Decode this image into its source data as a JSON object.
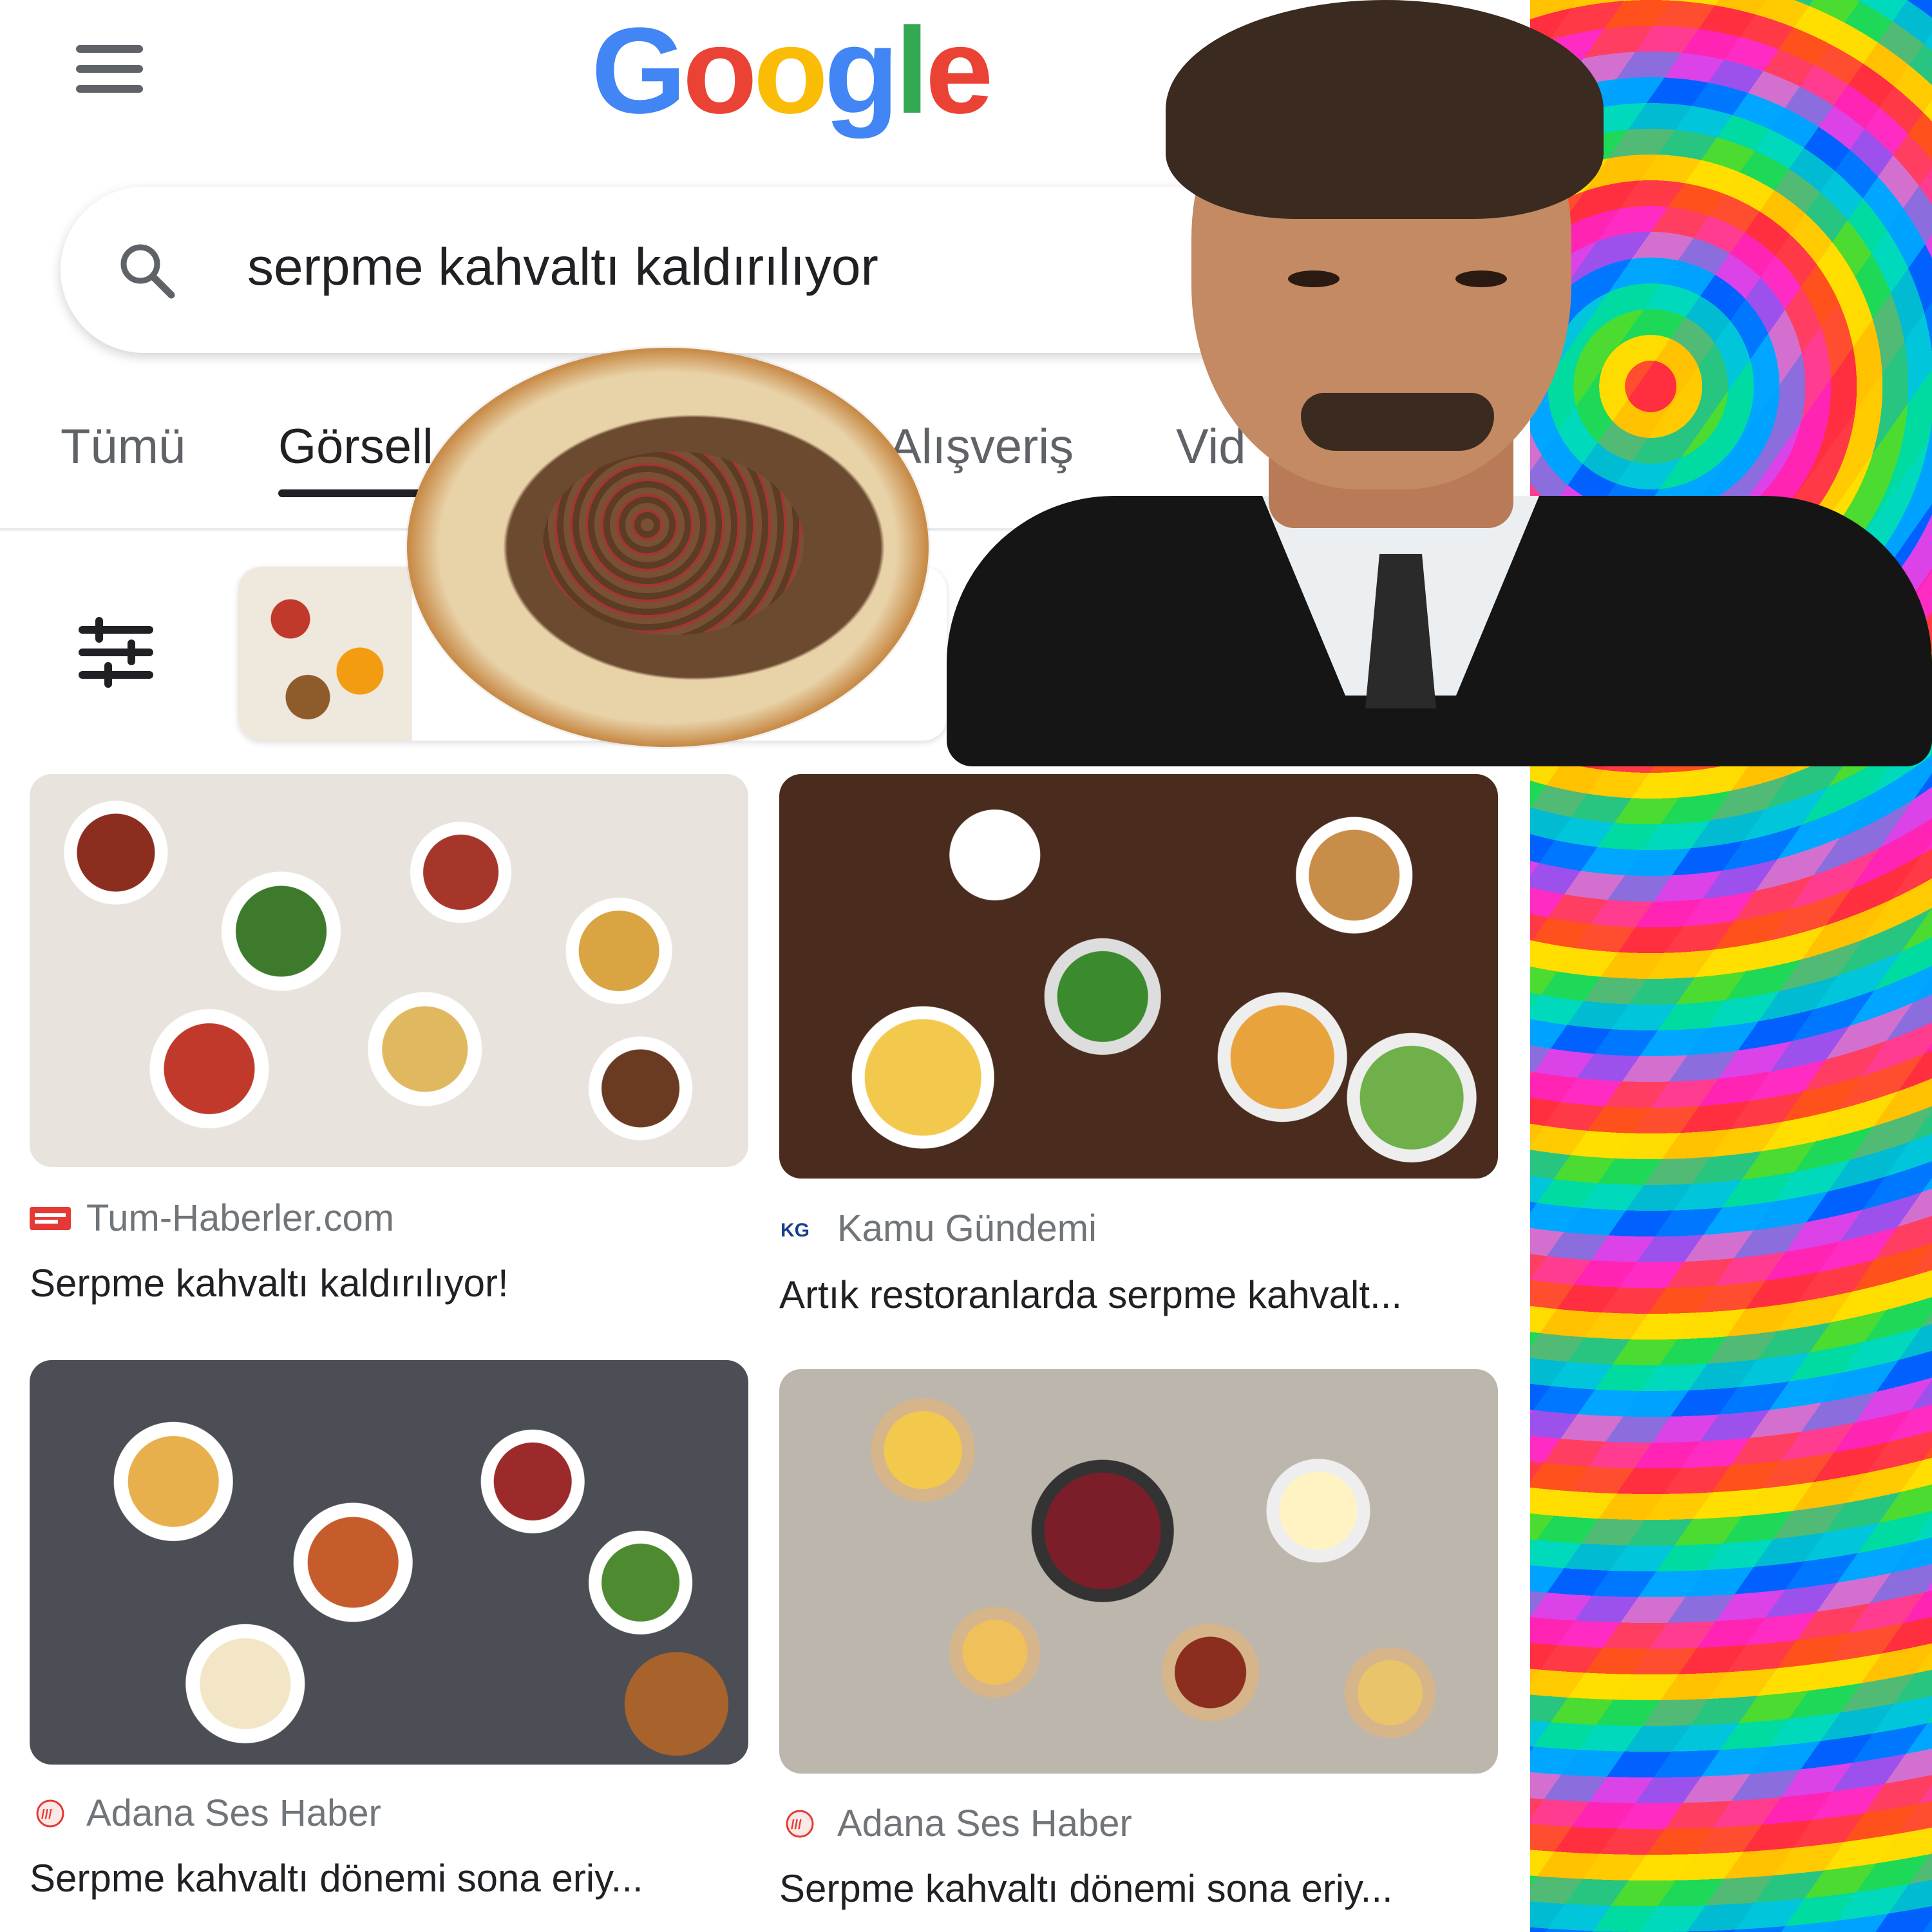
{
  "header": {
    "menu_icon": "hamburger-menu-icon",
    "logo_letters": [
      {
        "char": "G",
        "color": "#4285F4"
      },
      {
        "char": "o",
        "color": "#EA4335"
      },
      {
        "char": "o",
        "color": "#FBBC05"
      },
      {
        "char": "g",
        "color": "#4285F4"
      },
      {
        "char": "l",
        "color": "#34A853"
      },
      {
        "char": "e",
        "color": "#EA4335"
      }
    ]
  },
  "search": {
    "query": "serpme kahvaltı kaldırılıyor",
    "icon": "search-icon"
  },
  "tabs": [
    {
      "label": "Tümü",
      "active": false
    },
    {
      "label": "Görsell",
      "active": true
    },
    {
      "label": "Alışveriş",
      "active": false
    },
    {
      "label": "Vid",
      "active": false
    }
  ],
  "filter": {
    "icon": "filter-sliders-icon"
  },
  "results": [
    {
      "source": "Tum-Haberler.com",
      "source_icon": "tum-haberler-favicon",
      "title": "Serpme kahvaltı kaldırılıyor!"
    },
    {
      "source": "Kamu Gündemi",
      "source_icon": "kamu-gundemi-favicon",
      "title": "Artık restoranlarda serpme kahvalt..."
    },
    {
      "source": "Adana Ses Haber",
      "source_icon": "adana-ses-haber-favicon",
      "title": "Serpme kahvaltı dönemi sona eriy..."
    },
    {
      "source": "Adana Ses Haber",
      "source_icon": "adana-ses-haber-favicon",
      "title": "Serpme kahvaltı dönemi sona eriy..."
    }
  ]
}
